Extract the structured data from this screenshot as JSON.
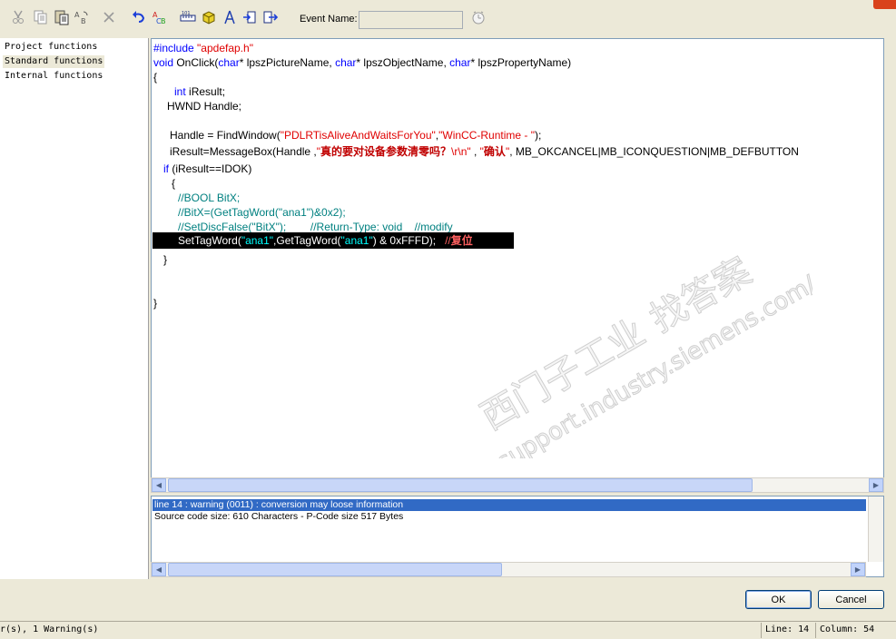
{
  "toolbar": {
    "event_name_label": "Event Name:",
    "event_name_value": "",
    "icons": [
      "cut-icon",
      "copy-icon",
      "paste-icon",
      "find-replace-icon",
      "delete-icon",
      "undo-icon",
      "abc-icon",
      "ruler-icon",
      "compile-icon",
      "tools-icon",
      "import-icon",
      "export-icon",
      "clock-icon"
    ]
  },
  "left_panel": {
    "items": [
      {
        "label": "Project functions",
        "selected": false
      },
      {
        "label": "Standard functions",
        "selected": true
      },
      {
        "label": "Internal functions",
        "selected": false
      }
    ]
  },
  "code": {
    "l1_kw": "#include",
    "l1_str": "\"apdefap.h\"",
    "l2_kw1": "void",
    "l2_t1": " OnClick(",
    "l2_kw2": "char",
    "l2_t2": "* lpszPictureName, ",
    "l2_kw3": "char",
    "l2_t3": "* lpszObjectName, ",
    "l2_kw4": "char",
    "l2_t4": "* lpszPropertyName)",
    "l3": "{",
    "l4_kw": "int",
    "l4_t": " iResult;",
    "l5": "HWND Handle;",
    "l7_t1": "Handle = FindWindow(",
    "l7_s1": "\"PDLRTisAliveAndWaitsForYou\"",
    "l7_t2": ",",
    "l7_s2": "\"WinCC-Runtime - \"",
    "l7_t3": ");",
    "l8_t1": "iResult=MessageBox(Handle ,",
    "l8_s1": "\"",
    "l8_cn1": "真的要对设备参数清零吗？",
    "l8_s2": "\\r\\n\"",
    "l8_t2": " , ",
    "l8_s3": "\"",
    "l8_cn2": "确认",
    "l8_s4": "\"",
    "l8_t3": ", MB_OKCANCEL|MB_ICONQUESTION|MB_DEFBUTTON",
    "l9_kw": "if",
    "l9_t": " (iResult==IDOK)",
    "l10": "{",
    "l11": "//BOOL BitX;",
    "l12": "//BitX=(GetTagWord(\"ana1\")&0x2);",
    "l13": "//SetDiscFalse(\"BitX\");        //Return-Type: void    //modify",
    "l14_t1": "SetTagWord(",
    "l14_s1": "\"ana1\"",
    "l14_t2": ",GetTagWord(",
    "l14_s2": "\"ana1\"",
    "l14_t3": ") & 0xFFFD);   ",
    "l14_cm": "//",
    "l14_cn": "复位",
    "l15": "}",
    "l18": "}"
  },
  "watermark": {
    "line1": "西门子工业",
    "line2": "找答案",
    "line3": "support.industry.siemens.com/cs"
  },
  "output": {
    "lines": [
      "line 14 : warning (0011) : conversion may loose information",
      "Source code size: 610 Characters - P-Code size 517 Bytes"
    ]
  },
  "buttons": {
    "ok": "OK",
    "cancel": "Cancel"
  },
  "status": {
    "message": "r(s), 1 Warning(s)",
    "line": "Line: 14",
    "column": "Column: 54"
  },
  "colors": {
    "keyword": "#0000ff",
    "string": "#e00000",
    "comment": "#008080",
    "selection": "#316ac5"
  }
}
